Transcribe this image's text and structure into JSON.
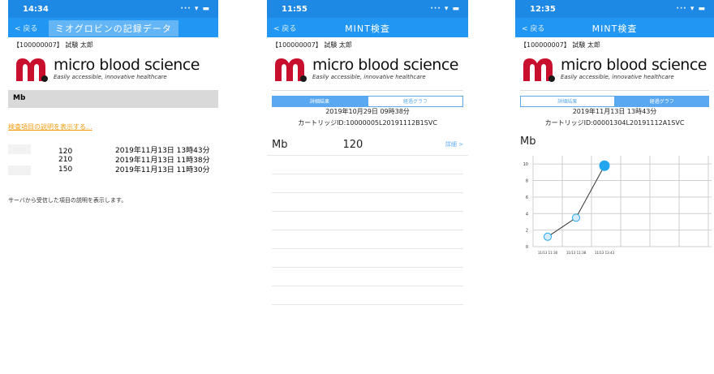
{
  "logo": {
    "brand": "micro blood science",
    "tagline": "Easily accessible, innovative healthcare"
  },
  "screen1": {
    "time": "14:34",
    "system": "··· ▾ ▬",
    "back": "< 戻る",
    "title": "ミオグロビンの記録データ",
    "patient": "【100000007】 試験 太郎",
    "item": "Mb",
    "help_link": "検査項目の説明を表示する...",
    "records": [
      {
        "value": "120",
        "date": "2019年11月13日 13時43分"
      },
      {
        "value": "210",
        "date": "2019年11月13日 11時38分"
      },
      {
        "value": "150",
        "date": "2019年11月13日 11時30分"
      }
    ],
    "description": "サーバから受信した項目の説明を表示します。"
  },
  "screen2": {
    "time": "11:55",
    "system": "··· ▾ ▬",
    "back": "< 戻る",
    "title": "MINT検査",
    "patient": "【100000007】 試験 太郎",
    "tabs": [
      "詳細結果",
      "経過グラフ"
    ],
    "date": "2019年10月29日 09時38分",
    "cartridge": "カートリッジID:10000005L20191112B1SVC",
    "item": "Mb",
    "value": "120",
    "more": "詳細 >"
  },
  "screen3": {
    "time": "12:35",
    "system": "··· ▾ ▬",
    "back": "< 戻る",
    "title": "MINT検査",
    "patient": "【100000007】 試験 太郎",
    "tabs": [
      "詳細結果",
      "経過グラフ"
    ],
    "date": "2019年11月13日 13時43分",
    "cartridge": "カートリッジID:00001304L20191112A1SVC",
    "item": "Mb"
  },
  "chart_data": {
    "type": "line",
    "x": [
      "11/13 11:30",
      "11/13 11:38",
      "11/13 13:43"
    ],
    "values": [
      1.2,
      3.5,
      9.8
    ],
    "yticks": [
      0,
      2,
      4,
      6,
      8,
      10
    ],
    "ylim": [
      0,
      11
    ],
    "grid": true
  },
  "colors": {
    "primary": "#2196f3",
    "status": "#1e88e5",
    "link": "#f39c12",
    "logo": "#c8102e",
    "accent": "#22a6f0"
  }
}
